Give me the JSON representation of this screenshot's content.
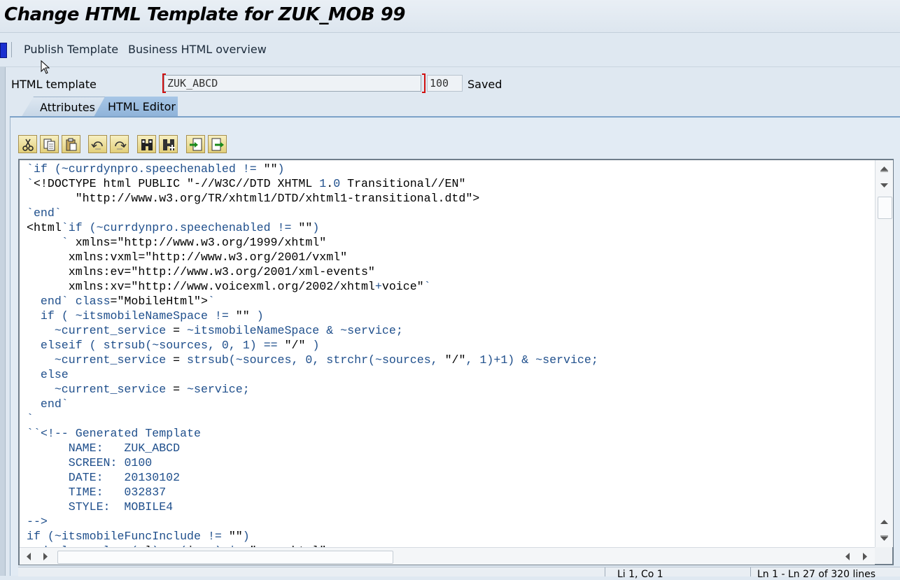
{
  "window": {
    "title": "Change HTML Template for ZUK_MOB 99"
  },
  "toolbar": {
    "publish_label": "Publish Template",
    "overview_label": "Business HTML overview"
  },
  "form": {
    "label": "HTML template",
    "template_value": "ZUK_ABCD",
    "screen_value": "100",
    "status": "Saved"
  },
  "tabs": [
    {
      "label": "Attributes",
      "active": false
    },
    {
      "label": "HTML Editor",
      "active": true
    }
  ],
  "editor_toolbar": {
    "icons": [
      "cut-icon",
      "copy-icon",
      "paste-icon",
      "undo-icon",
      "redo-icon",
      "find-icon",
      "find-next-icon",
      "import-icon",
      "export-icon"
    ]
  },
  "editor": {
    "lines": [
      "`if (~currdynpro.speechenabled != \"\")",
      "`<!DOCTYPE html PUBLIC \"-//W3C//DTD XHTML 1.0 Transitional//EN\"",
      "       \"http://www.w3.org/TR/xhtml1/DTD/xhtml1-transitional.dtd\">",
      "`end`",
      "<html`if (~currdynpro.speechenabled != \"\")",
      "     ` xmlns=\"http://www.w3.org/1999/xhtml\"",
      "      xmlns:vxml=\"http://www.w3.org/2001/vxml\"",
      "      xmlns:ev=\"http://www.w3.org/2001/xml-events\"",
      "      xmlns:xv=\"http://www.voicexml.org/2002/xhtml+voice\"`",
      "  end` class=\"MobileHtml\">`",
      "  if ( ~itsmobileNameSpace != \"\" )",
      "    ~current_service = ~itsmobileNameSpace & ~service;",
      "  elseif ( strsub(~sources, 0, 1) == \"/\" )",
      "    ~current_service = strsub(~sources, 0, strchr(~sources, \"/\", 1)+1) & ~service;",
      "  else",
      "    ~current_service = ~service;",
      "  end`",
      "`",
      "``<!-- Generated Template",
      "      NAME:   ZUK_ABCD",
      "      SCREEN: 0100",
      "      DATE:   20130102",
      "      TIME:   032837",
      "      STYLE:  MOBILE4",
      "-->",
      "if (~itsmobileFuncInclude != \"\")",
      "  declare class(al)...(i...) in \"some.html\";"
    ]
  },
  "statusbar": {
    "cursor_pos": "Li 1, Co 1",
    "line_info": "Ln 1 - Ln 27 of 320 lines"
  },
  "colors": {
    "code_blue": "#1f4f8c",
    "active_tab": "#9dbde0",
    "bracket_red": "#d01010"
  }
}
